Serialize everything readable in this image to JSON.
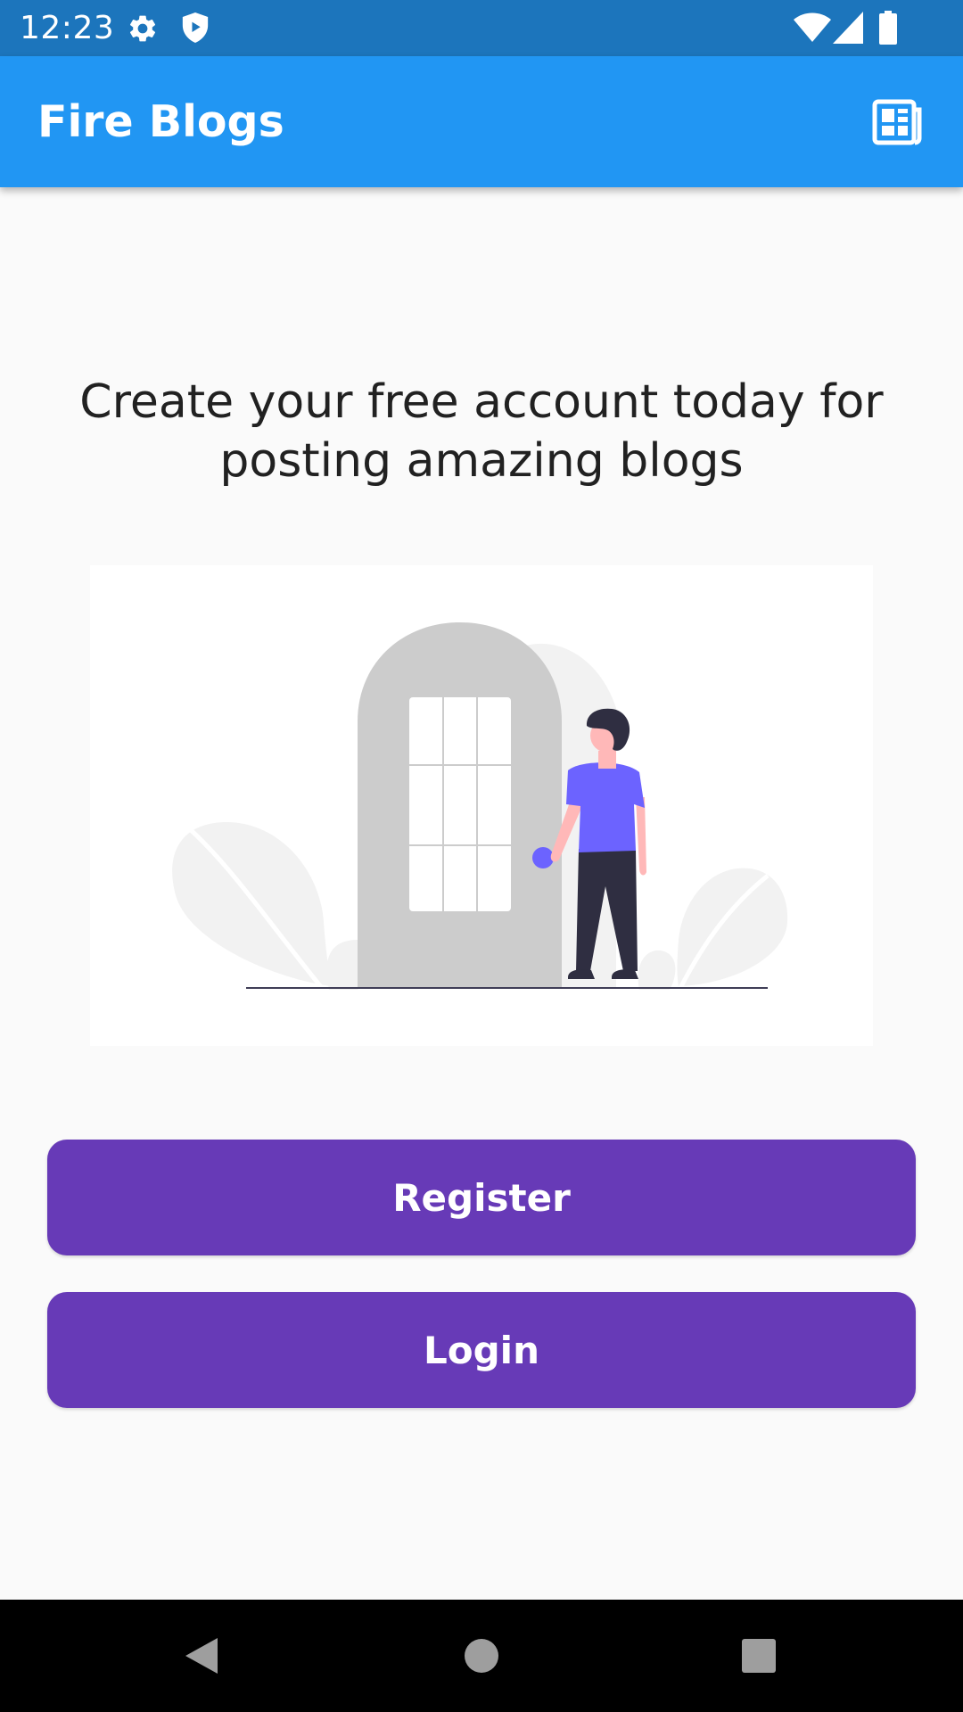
{
  "status_bar": {
    "time": "12:23",
    "left_icons": [
      "gear-icon",
      "shield-icon"
    ],
    "right_icons": [
      "wifi-icon",
      "cell-signal-icon",
      "battery-icon"
    ]
  },
  "app_bar": {
    "title": "Fire Blogs",
    "action_icon": "newspaper-icon",
    "color": "#2196f3"
  },
  "main": {
    "headline": "Create your free account today for posting amazing blogs",
    "illustration": "person-at-door-illustration",
    "buttons": {
      "register_label": "Register",
      "login_label": "Login"
    },
    "button_color": "#673ab7"
  },
  "nav_bar": {
    "items": [
      "back-icon",
      "home-icon",
      "recents-icon"
    ]
  },
  "colors": {
    "status_bar": "#1c75bc",
    "background": "#fafafa",
    "illustration_accent": "#6c63ff"
  }
}
